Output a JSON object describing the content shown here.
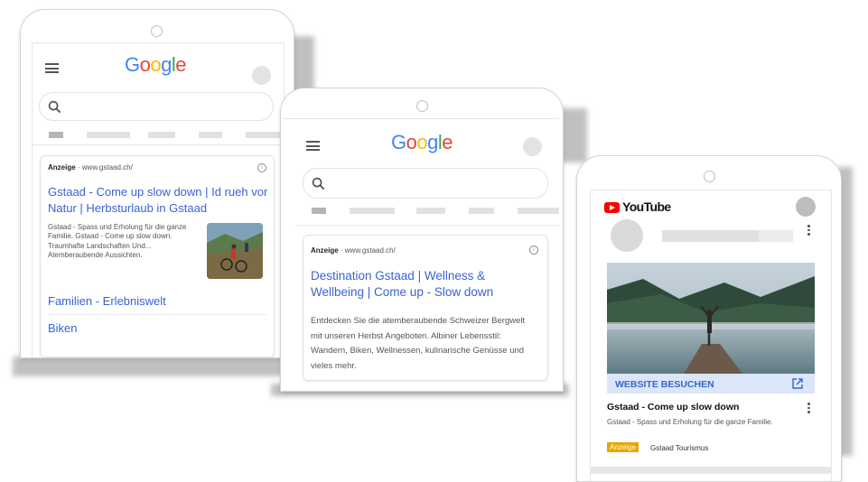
{
  "phone1": {
    "logo": "Google",
    "ad": {
      "label": "Anzeige",
      "url": "www.gstaad.ch/",
      "title": "Gstaad - Come up slow down | Id rueh vor Natur | Herbsturlaub in Gstaad",
      "description": "Gstaad - Spass und Erholung für die ganze Familie. Gstaad - Come up slow down. Traumhafte Landschaften Und... Atemberaubende Aussichten.",
      "sitelinks": [
        "Familien - Erlebniswelt",
        "Biken"
      ]
    }
  },
  "phone2": {
    "logo": "Google",
    "ad": {
      "label": "Anzeige",
      "url": "www.gstaad.ch/",
      "title": "Destination Gstaad | Wellness & Wellbeing | Come up - Slow down",
      "description": "Entdecken Sie die atemberaubende Schweizer Bergwelt mit unseren Herbst Angeboten. Albiner Lebensstil: Wandern, Biken, Wellnessen, kulinarische Genüsse und vieles mehr."
    }
  },
  "phone3": {
    "logo": "YouTube",
    "cta": "WEBSITE BESUCHEN",
    "title": "Gstaad - Come up slow down",
    "description": "Gstaad - Spass und Erholung für die ganze Familie.",
    "badge": "Anzeige",
    "advertiser": "Gstaad Tourismus"
  },
  "colors": {
    "link": "#3b62d4",
    "badge": "#e7a700",
    "cta_bg": "#dbe6f8",
    "youtube_red": "#ff0000"
  }
}
